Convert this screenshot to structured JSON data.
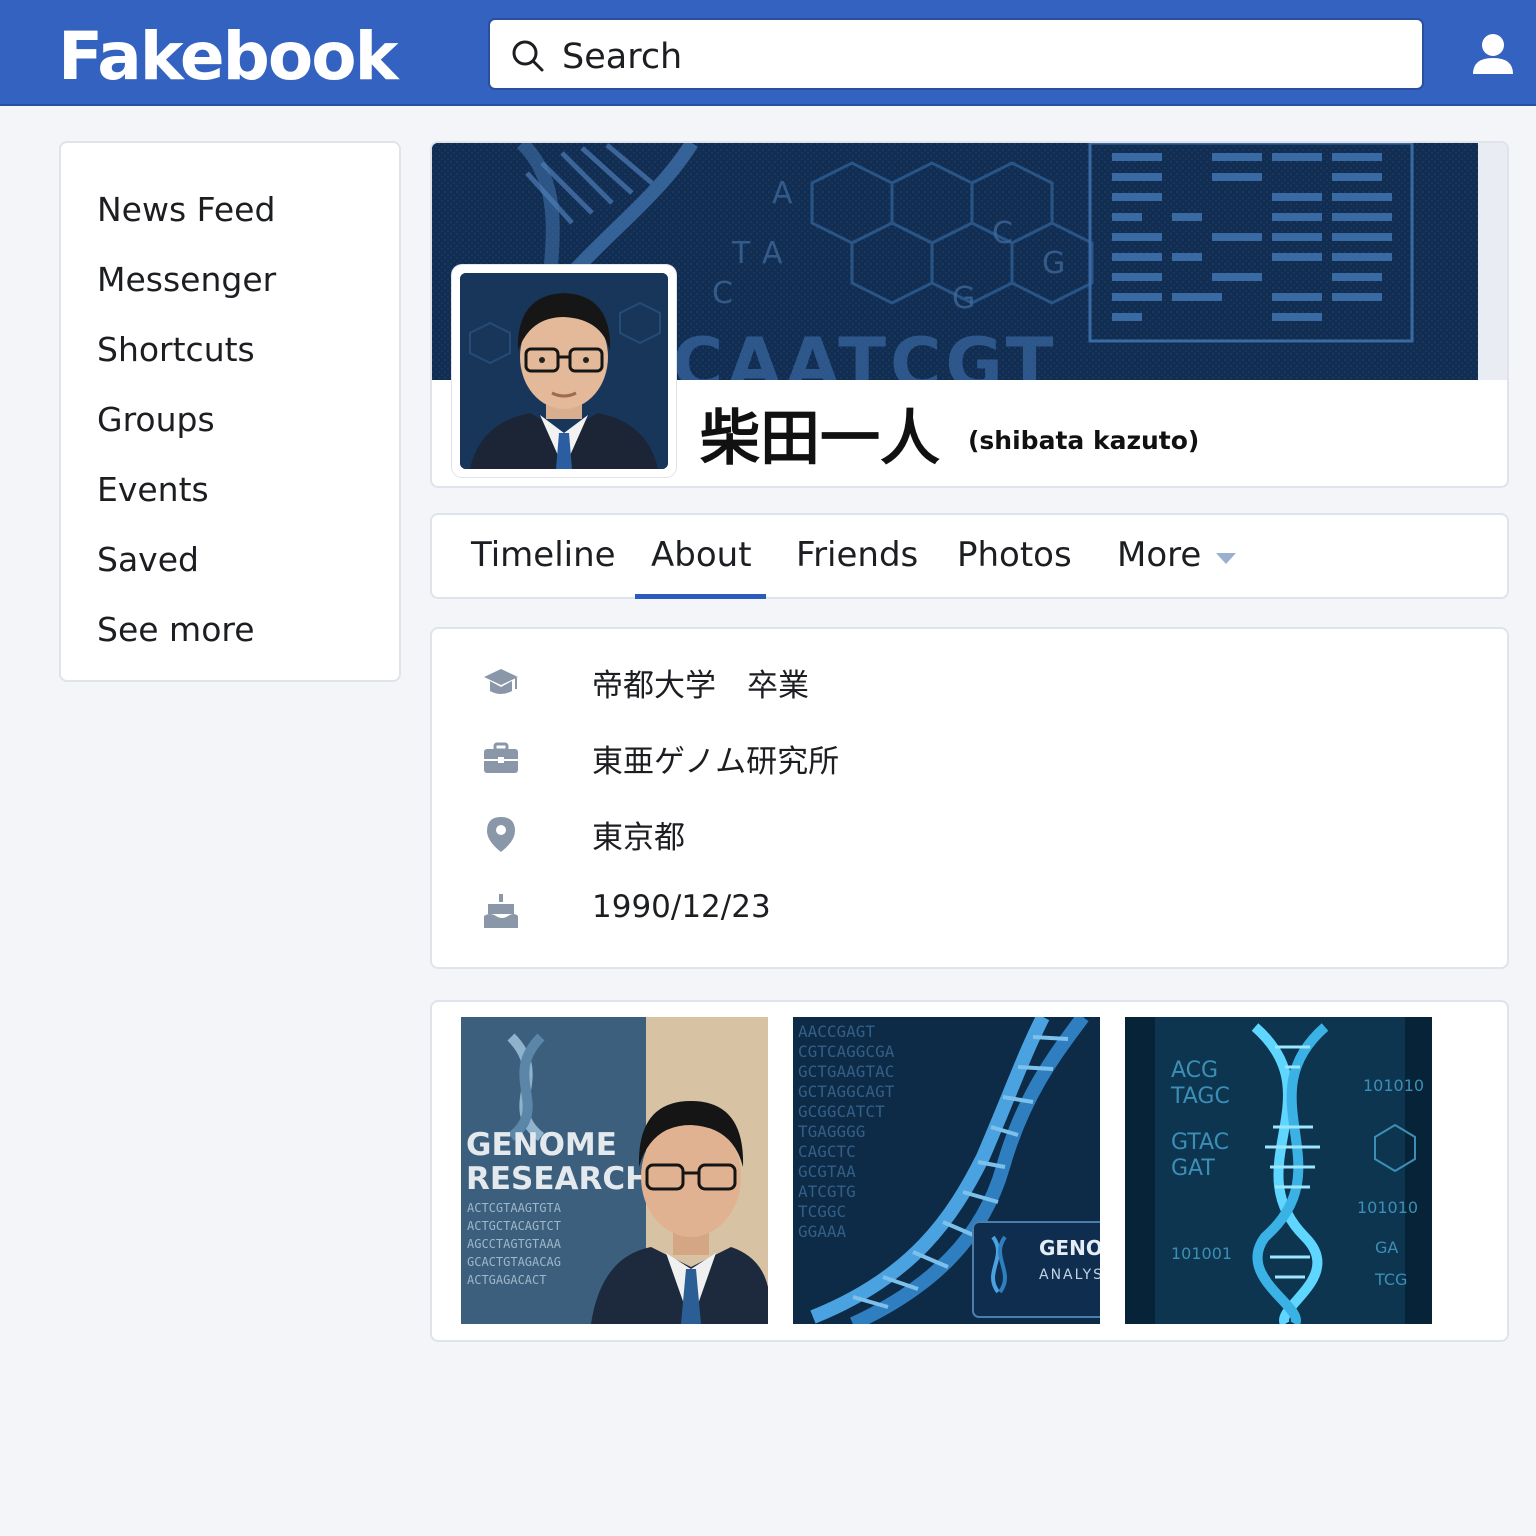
{
  "header": {
    "logo": "Fakebook",
    "search_placeholder": "Search",
    "icons": {
      "search": "search-icon",
      "user": "user-icon"
    }
  },
  "sidebar": {
    "items": [
      {
        "label": "News Feed"
      },
      {
        "label": "Messenger"
      },
      {
        "label": "Shortcuts"
      },
      {
        "label": "Groups"
      },
      {
        "label": "Events"
      },
      {
        "label": "Saved"
      },
      {
        "label": "See more"
      }
    ]
  },
  "profile": {
    "name": "柴田一人",
    "romaji": "(shibata kazuto)",
    "cover_text": "CAATCGT",
    "cover_letters": [
      "A",
      "T",
      "G",
      "C",
      "A",
      "G",
      "C"
    ]
  },
  "tabs": {
    "items": [
      {
        "label": "Timeline"
      },
      {
        "label": "About"
      },
      {
        "label": "Friends"
      },
      {
        "label": "Photos"
      },
      {
        "label": "More"
      }
    ],
    "active": "About"
  },
  "about": {
    "rows": [
      {
        "icon": "graduation-cap-icon",
        "text": "帝都大学　卒業"
      },
      {
        "icon": "briefcase-icon",
        "text": "東亜ゲノム研究所"
      },
      {
        "icon": "location-pin-icon",
        "text": "東京都"
      },
      {
        "icon": "birthday-cake-icon",
        "text": "1990/12/23"
      }
    ]
  },
  "photos": {
    "photo1": {
      "line1": "GENOME",
      "line2": "RESEARCH",
      "seq": [
        "ACTCGTAAGTGTA",
        "ACTGCTACAGTCT",
        "AGCCTAGTGTAAA",
        "GCACTGTAGACAG",
        "ACTGAGACACT"
      ]
    },
    "photo2": {
      "card_title": "GENON",
      "card_sub": "ANALYS"
    },
    "photo3": {
      "left": [
        "ACG",
        "TAGC",
        "GTAC",
        "GAT"
      ],
      "right": [
        "101010",
        "101010",
        "101001",
        "GA",
        "TCG"
      ]
    }
  },
  "colors": {
    "brand": "#3462c0",
    "active_tab": "#2a5bbf",
    "icon_gray": "#8a97a8",
    "page_bg": "#f3f5f9"
  }
}
